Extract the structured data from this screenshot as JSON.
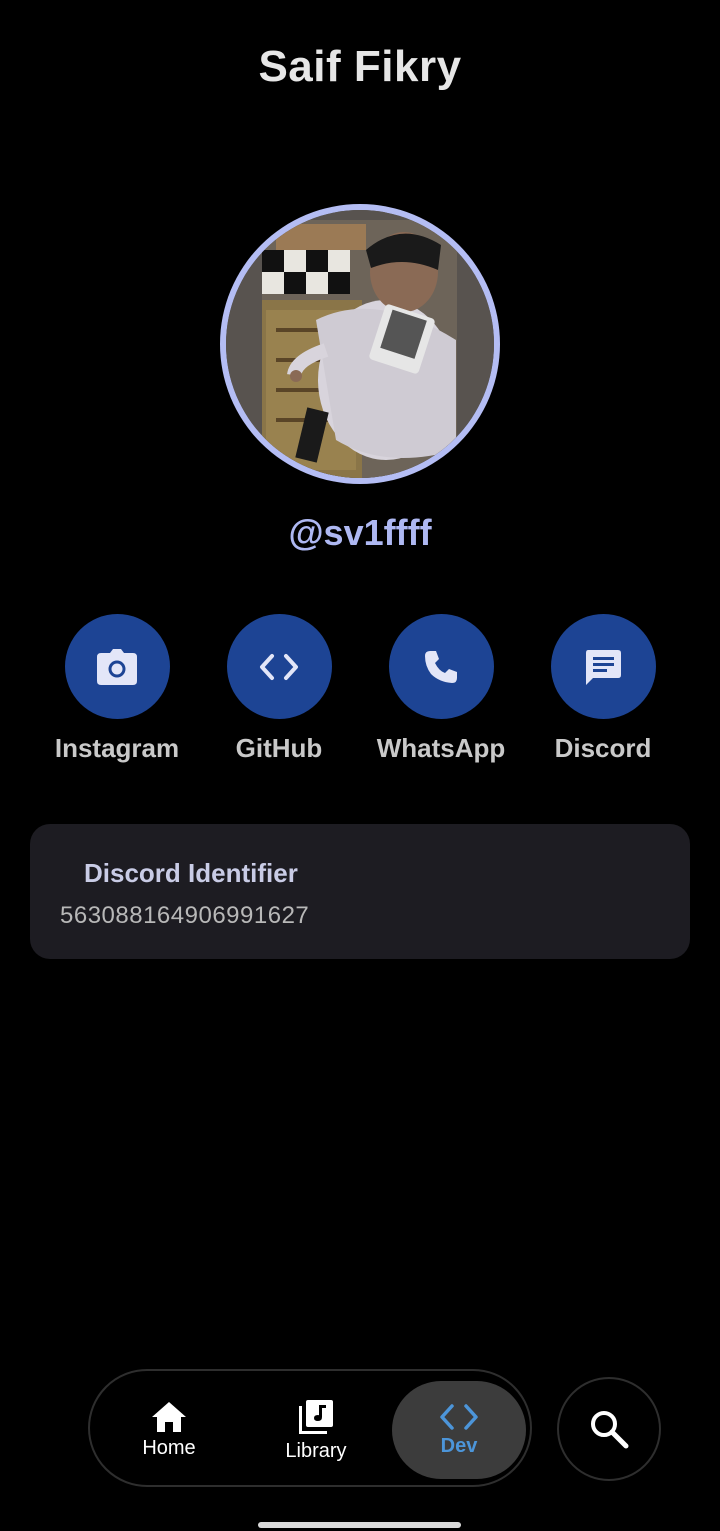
{
  "header": {
    "title": "Saif Fikry"
  },
  "profile": {
    "handle": "@sv1ffff"
  },
  "socials": [
    {
      "label": "Instagram",
      "icon": "camera-icon"
    },
    {
      "label": "GitHub",
      "icon": "code-icon"
    },
    {
      "label": "WhatsApp",
      "icon": "phone-icon"
    },
    {
      "label": "Discord",
      "icon": "chat-icon"
    }
  ],
  "discord_card": {
    "title": "Discord Identifier",
    "value": "563088164906991627"
  },
  "nav": {
    "items": [
      {
        "label": "Home",
        "icon": "home-icon",
        "active": false
      },
      {
        "label": "Library",
        "icon": "library-icon",
        "active": false
      },
      {
        "label": "Dev",
        "icon": "code-icon",
        "active": true
      }
    ],
    "search_icon": "search-icon"
  },
  "colors": {
    "background": "#000000",
    "accent_circle": "#1d4494",
    "handle": "#aeb8f2",
    "avatar_ring": "#b4bdf4",
    "card_bg": "#1d1c22",
    "active_nav_text": "#4c95d9"
  }
}
